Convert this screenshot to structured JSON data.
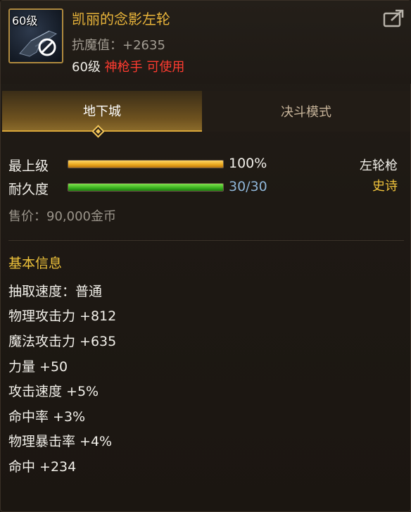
{
  "item": {
    "icon_level": "60级",
    "name": "凯丽的念影左轮",
    "resist": "抗魔值：+2635",
    "req_level": "60级",
    "req_class": "神枪手 可使用"
  },
  "tabs": [
    {
      "label": "地下城",
      "active": true
    },
    {
      "label": "决斗模式",
      "active": false
    }
  ],
  "bars": {
    "upgrade": {
      "label": "最上级",
      "value_text": "100%",
      "fill": 1.0
    },
    "durability": {
      "label": "耐久度",
      "value_text": "30/30",
      "fill": 1.0
    }
  },
  "weapon_type": "左轮枪",
  "rarity": "史诗",
  "price": "售价：90,000金币",
  "basic_info": {
    "title": "基本信息",
    "stats": [
      "抽取速度：普通",
      "物理攻击力 +812",
      "魔法攻击力 +635",
      "力量 +50",
      "攻击速度 +5%",
      "命中率 +3%",
      "物理暴击率 +4%",
      "命中 +234"
    ]
  },
  "colors": {
    "name": "#e8b43a",
    "class_req": "#ff3b30",
    "rarity": "#f0c33b",
    "durability_value": "#8fb6d8"
  },
  "icons": [
    "revolver-icon",
    "no-entry-icon",
    "share-icon",
    "tab-diamond-icon"
  ]
}
